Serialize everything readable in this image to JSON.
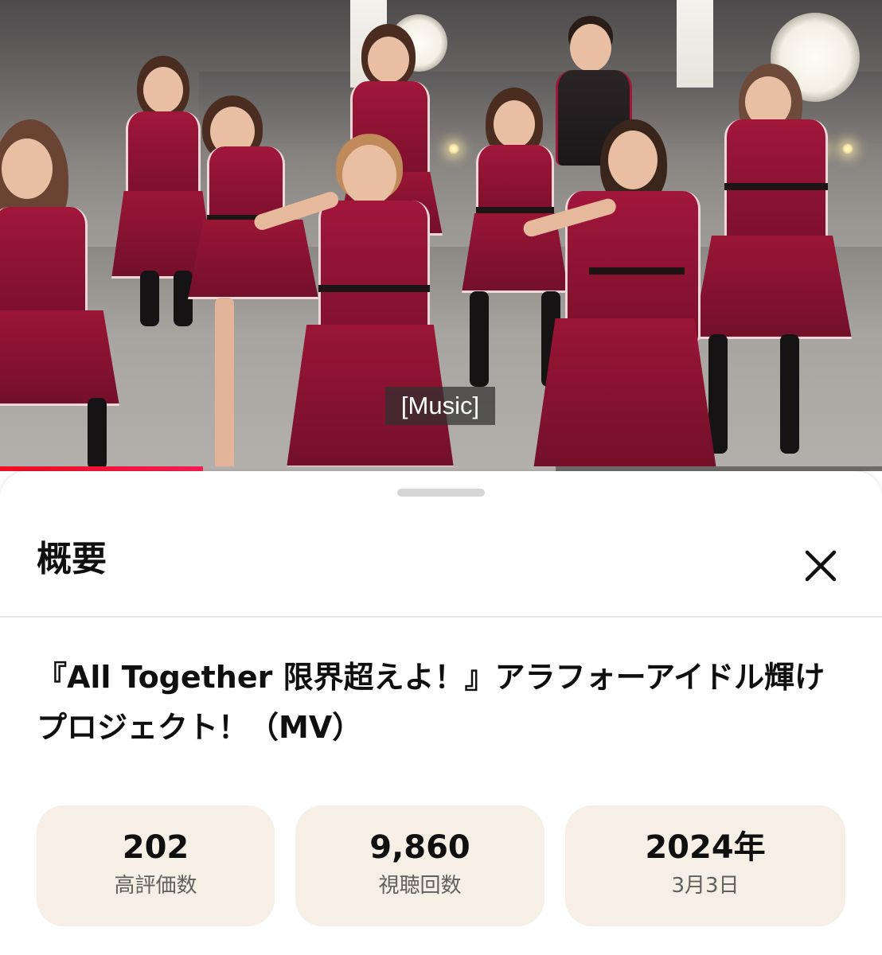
{
  "video": {
    "caption": "[Music]",
    "progress": {
      "played_fraction": 0.23,
      "buffered_fraction": 0.63,
      "played_color": "#ff0033"
    }
  },
  "sheet": {
    "title": "概要",
    "close_icon": "close-icon",
    "video_title": "『All Together 限界超えよ！』アラフォーアイドル輝けプロジェクト！（MV）",
    "stats": {
      "likes": {
        "value": "202",
        "label": "高評価数"
      },
      "views": {
        "value": "9,860",
        "label": "視聴回数"
      },
      "date": {
        "value": "2024年",
        "label": "3月3日"
      }
    }
  }
}
